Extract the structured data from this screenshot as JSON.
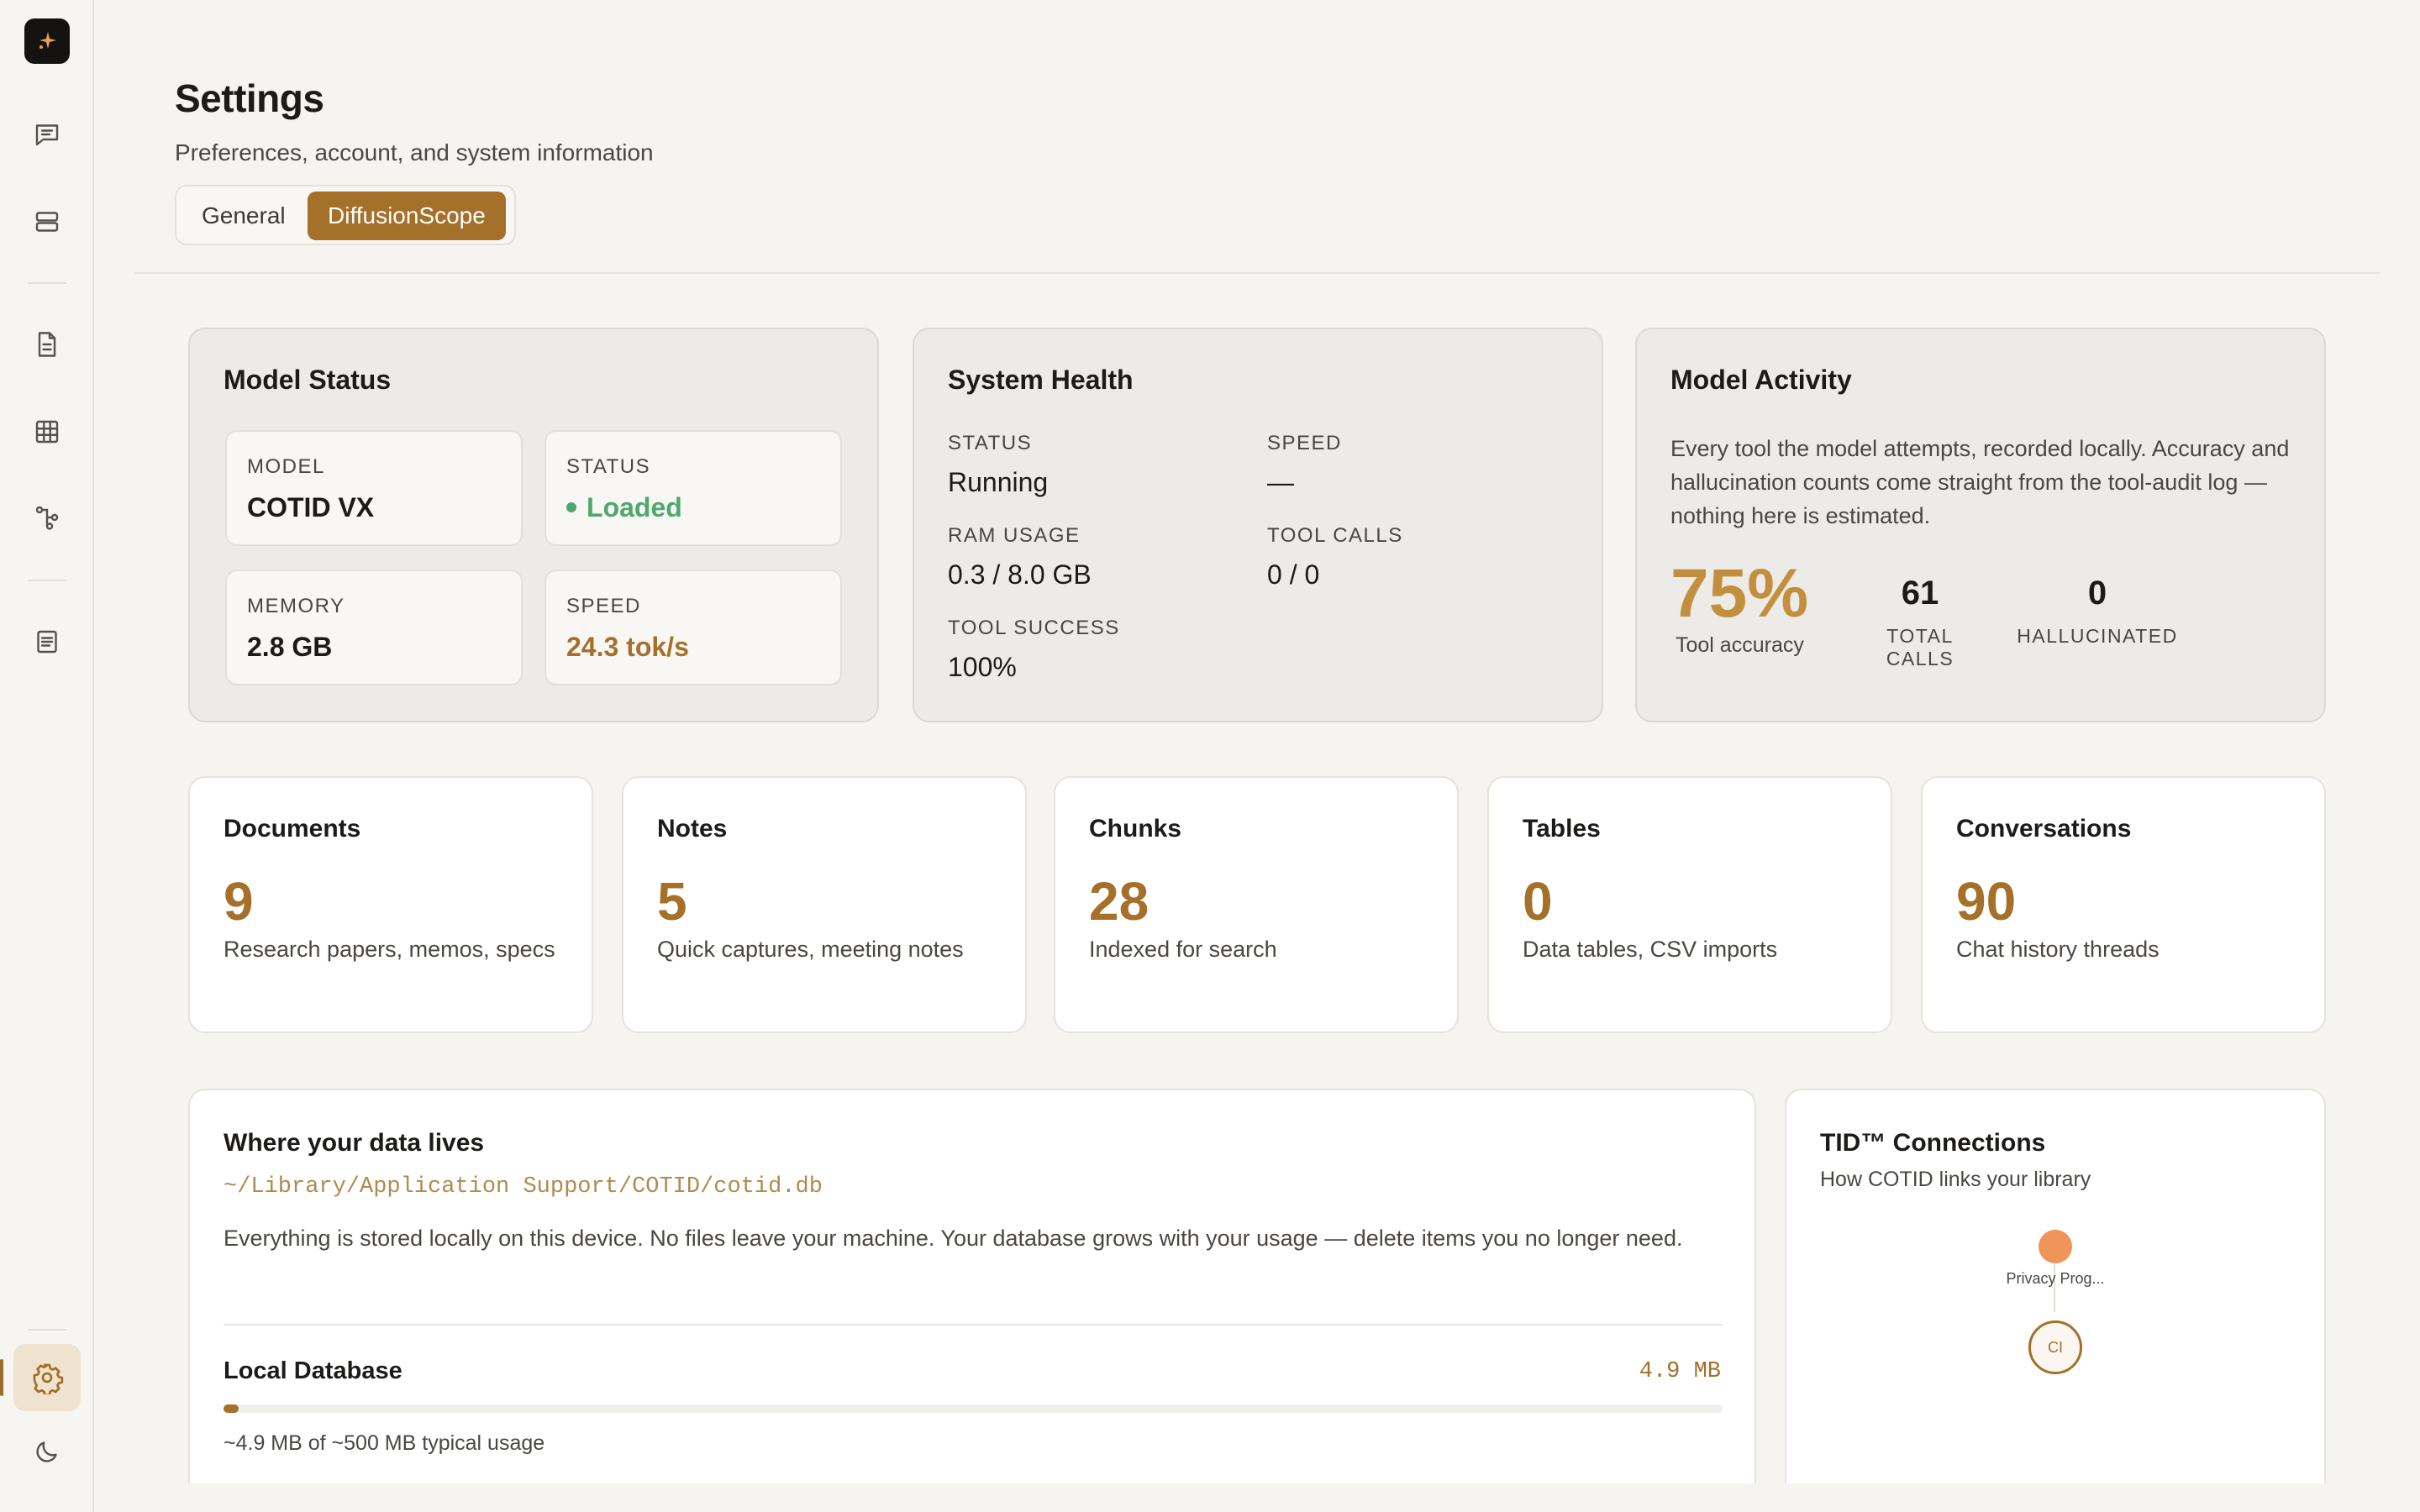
{
  "header": {
    "title": "Settings",
    "subtitle": "Preferences, account, and system information",
    "tabs": [
      {
        "label": "General",
        "active": false
      },
      {
        "label": "DiffusionScope",
        "active": true
      }
    ]
  },
  "sidebar": {
    "icons": [
      "chat-icon",
      "server-icon",
      "document-icon",
      "table-icon",
      "graph-icon",
      "notes-icon",
      "settings-icon",
      "moon-icon"
    ],
    "active": "settings-icon"
  },
  "model_status": {
    "title": "Model Status",
    "model_label": "MODEL",
    "model_value": "COTID VX",
    "status_label": "STATUS",
    "status_value": "Loaded",
    "memory_label": "MEMORY",
    "memory_value": "2.8 GB",
    "speed_label": "SPEED",
    "speed_value": "24.3 tok/s"
  },
  "system_health": {
    "title": "System Health",
    "status_label": "STATUS",
    "status_value": "Running",
    "speed_label": "SPEED",
    "speed_value": "—",
    "ram_label": "RAM USAGE",
    "ram_value": "0.3 / 8.0 GB",
    "tool_calls_label": "TOOL CALLS",
    "tool_calls_value": "0 / 0",
    "tool_success_label": "TOOL SUCCESS",
    "tool_success_value": "100%"
  },
  "model_activity": {
    "title": "Model Activity",
    "description": "Every tool the model attempts, recorded locally. Accuracy and hallucination counts come straight from the tool-audit log — nothing here is estimated.",
    "accuracy_value": "75%",
    "accuracy_label": "Tool accuracy",
    "total_calls_value": "61",
    "total_calls_label": "TOTAL CALLS",
    "hallucinated_value": "0",
    "hallucinated_label": "HALLUCINATED"
  },
  "stats": [
    {
      "title": "Documents",
      "value": "9",
      "desc": "Research papers, memos, specs"
    },
    {
      "title": "Notes",
      "value": "5",
      "desc": "Quick captures, meeting notes"
    },
    {
      "title": "Chunks",
      "value": "28",
      "desc": "Indexed for search"
    },
    {
      "title": "Tables",
      "value": "0",
      "desc": "Data tables, CSV imports"
    },
    {
      "title": "Conversations",
      "value": "90",
      "desc": "Chat history threads"
    }
  ],
  "data_location": {
    "title": "Where your data lives",
    "path": "~/Library/Application Support/COTID/cotid.db",
    "description": "Everything is stored locally on this device. No files leave your machine. Your database grows with your usage — delete items you no longer need.",
    "db_label": "Local Database",
    "db_size": "4.9 MB",
    "usage_text": "~4.9 MB of ~500 MB typical usage",
    "usage_fraction": 0.0098
  },
  "connections": {
    "title": "TID™ Connections",
    "subtitle": "How COTID links your library",
    "node_label": "Privacy Prog...",
    "node_initials": "CI"
  },
  "colors": {
    "accent": "#a4702a",
    "success": "#4ea86e",
    "node": "#f0955a"
  }
}
